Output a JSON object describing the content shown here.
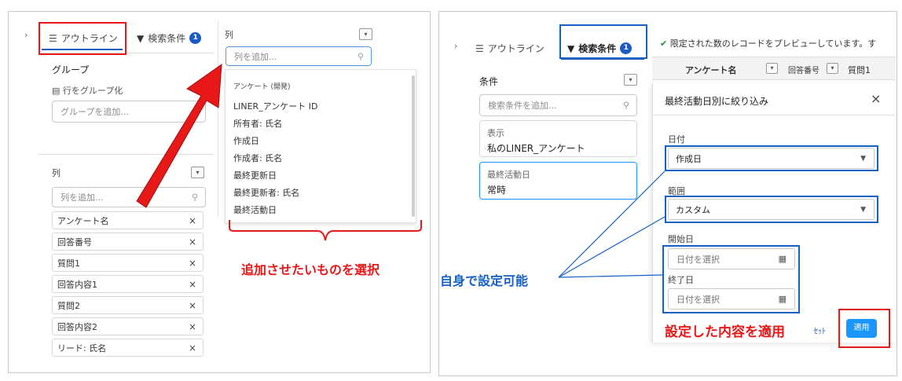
{
  "left": {
    "tab_outline": "アウトライン",
    "tab_filter": "検索条件",
    "filter_count": "1",
    "group_header": "グループ",
    "group_by_rows": "行をグループ化",
    "group_placeholder": "グループを追加...",
    "columns_header": "列",
    "columns_placeholder": "列を追加...",
    "column_pills": [
      "アンケート名",
      "回答番号",
      "質問1",
      "回答内容1",
      "質問2",
      "回答内容2",
      "リード: 氏名"
    ],
    "popup_header": "列",
    "popup_placeholder": "列を追加...",
    "popup_section": "アンケート (開発)",
    "popup_items": [
      "LINER_アンケート ID",
      "所有者: 氏名",
      "作成日",
      "作成者: 氏名",
      "最終更新日",
      "最終更新者: 氏名",
      "最終活動日"
    ],
    "annotation": "追加させたいものを選択"
  },
  "right": {
    "tab_outline": "アウトライン",
    "tab_filter": "検索条件",
    "filter_count": "1",
    "preview_notice": "限定された数のレコードをプレビューしています。す",
    "table_headers": [
      "アンケート名",
      "回答番号",
      "質問1"
    ],
    "conditions_header": "条件",
    "conditions_placeholder": "検索条件を追加...",
    "show_label": "表示",
    "show_value": "私のLINER_アンケート",
    "last_activity_label": "最終活動日",
    "last_activity_value": "常時",
    "panel_title": "最終活動日別に絞り込み",
    "date_label": "日付",
    "date_value": "作成日",
    "range_label": "範囲",
    "range_value": "カスタム",
    "start_label": "開始日",
    "start_placeholder": "日付を選択",
    "end_label": "終了日",
    "end_placeholder": "日付を選択",
    "reset_label": "ｾｯﾄ",
    "apply_label": "適用",
    "annotation_self": "自身で設定可能",
    "annotation_apply": "設定した内容を適用"
  },
  "colors": {
    "accent_blue": "#1b5bc5",
    "annotation_red": "#e81818",
    "annotation_blue": "#1662c4"
  }
}
